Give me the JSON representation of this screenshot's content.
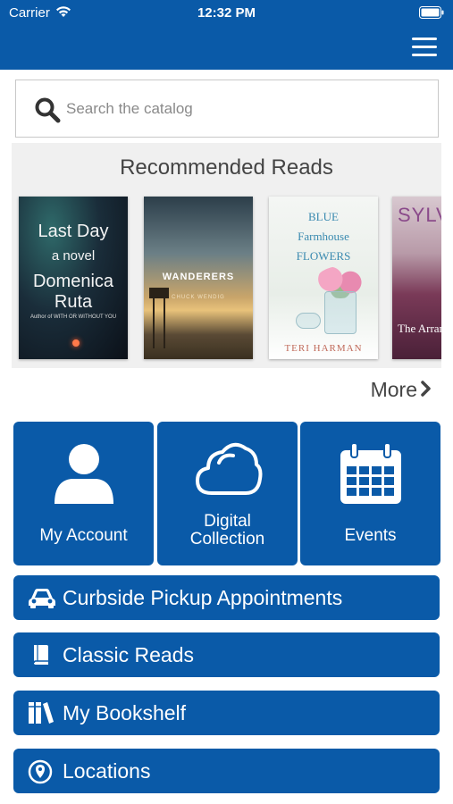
{
  "status_bar": {
    "carrier": "Carrier",
    "time": "12:32 PM"
  },
  "search": {
    "placeholder": "Search the catalog"
  },
  "recommended": {
    "title": "Recommended Reads",
    "more_label": "More",
    "books": [
      {
        "title": "Last Day",
        "subtitle": "a novel",
        "author": "Domenica Ruta",
        "tagline": "Author of WITH OR WITHOUT YOU"
      },
      {
        "title": "WANDERERS",
        "author": "CHUCK WENDIG"
      },
      {
        "title": "BLUE Farmhouse FLOWERS",
        "author": "TERI HARMAN"
      },
      {
        "title": "SYLV",
        "subtitle": "The Arran"
      }
    ]
  },
  "tiles": [
    {
      "label": "My Account",
      "icon": "user-icon"
    },
    {
      "label": "Digital Collection",
      "label_line1": "Digital",
      "label_line2": "Collection",
      "icon": "cloud-icon"
    },
    {
      "label": "Events",
      "icon": "calendar-icon"
    }
  ],
  "menu": [
    {
      "label": "Curbside Pickup Appointments",
      "icon": "car-icon"
    },
    {
      "label": "Classic Reads",
      "icon": "book-icon"
    },
    {
      "label": "My Bookshelf",
      "icon": "bookshelf-icon"
    },
    {
      "label": "Locations",
      "icon": "location-pin-icon"
    }
  ],
  "colors": {
    "brand": "#0a5aa8",
    "panel": "#f0f0f0"
  }
}
